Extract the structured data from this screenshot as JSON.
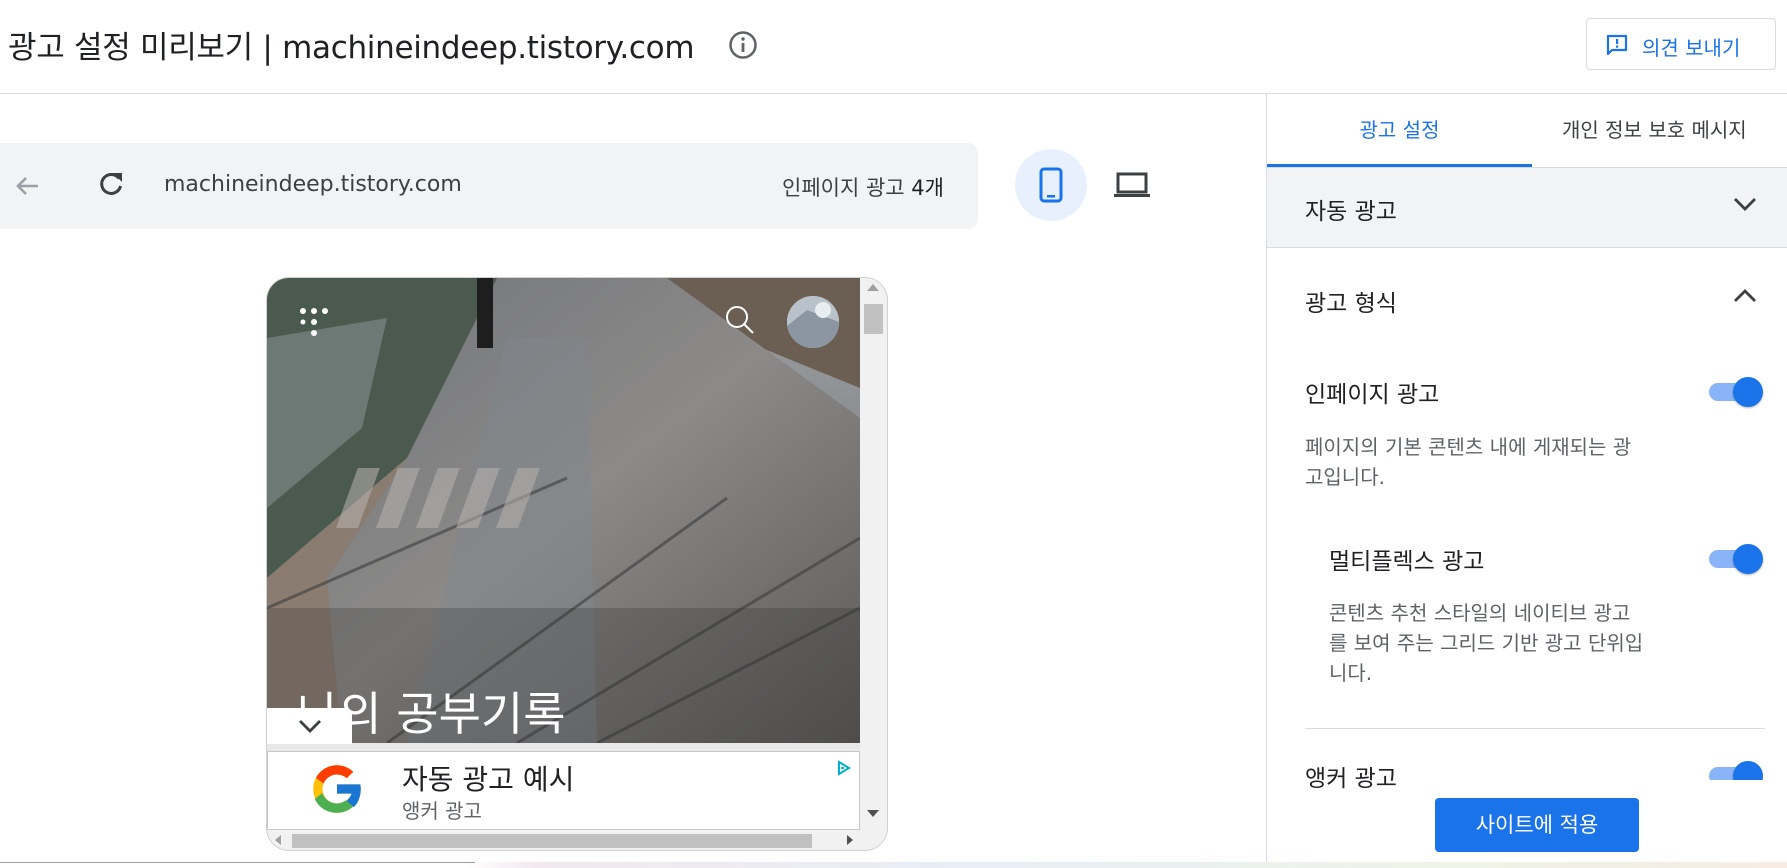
{
  "header": {
    "title": "광고 설정 미리보기 | machineindeep.tistory.com",
    "feedback_label": "의견 보내기"
  },
  "browser": {
    "url": "machineindeep.tistory.com",
    "ad_count_prefix": "인페이지 광고",
    "ad_count_value": "4개"
  },
  "preview": {
    "blog_title": "나의 공부기록",
    "anchor_ad": {
      "title": "자동 광고 예시",
      "subtitle": "앵커 광고"
    }
  },
  "panel": {
    "tabs": [
      "광고 설정",
      "개인 정보 보호 메시지"
    ],
    "auto_ads_label": "자동 광고",
    "ad_formats_label": "광고 형식",
    "inpage": {
      "label": "인페이지 광고",
      "description_line1": "페이지의 기본 콘텐츠 내에 게재되는 광",
      "description_line2": "고입니다.",
      "enabled": true
    },
    "multiplex": {
      "label": "멀티플렉스 광고",
      "description_line1": "콘텐츠 추천 스타일의 네이티브 광고",
      "description_line2": "를 보여 주는 그리드 기반 광고 단위입",
      "description_line3": "니다.",
      "enabled": true
    },
    "anchor": {
      "label": "앵커 광고",
      "enabled": true
    },
    "apply_label": "사이트에 적용"
  },
  "colors": {
    "accent": "#1a73e8",
    "toggle_track": "#8ab4f8",
    "panel_header_bg": "#f1f3f4"
  },
  "icons": [
    "info-icon",
    "feedback-icon",
    "back-arrow-icon",
    "reload-icon",
    "smartphone-icon",
    "laptop-icon",
    "menu-dots-icon",
    "search-icon",
    "chevron-down-icon",
    "chevron-up-icon",
    "google-logo-icon",
    "adchoices-icon"
  ]
}
